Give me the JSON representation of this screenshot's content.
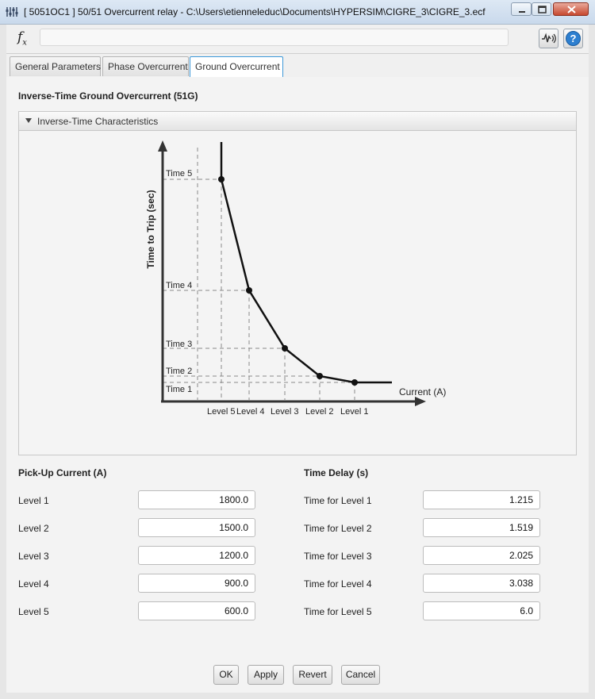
{
  "window": {
    "title": "[ 5051OC1 ]  50/51 Overcurrent relay - C:\\Users\\etienneleduc\\Documents\\HYPERSIM\\CIGRE_3\\CIGRE_3.ecf"
  },
  "toolbar": {
    "formula_value": ""
  },
  "tabs": [
    {
      "label": "General Parameters"
    },
    {
      "label": "Phase Overcurrent"
    },
    {
      "label": "Ground Overcurrent"
    }
  ],
  "section_title": "Inverse-Time Ground Overcurrent (51G)",
  "panel_title": "Inverse-Time Characteristics",
  "diagram": {
    "y_axis_label": "Time to Trip (sec)",
    "x_axis_label": "Current (A)",
    "time_labels": [
      "Time 5",
      "Time 4",
      "Time 3",
      "Time 2",
      "Time 1"
    ],
    "level_labels": [
      "Level 5",
      "Level 4",
      "Level 3",
      "Level 2",
      "Level 1"
    ]
  },
  "pickup": {
    "title": "Pick-Up Current (A)",
    "rows": [
      {
        "label": "Level 1",
        "value": "1800.0"
      },
      {
        "label": "Level 2",
        "value": "1500.0"
      },
      {
        "label": "Level 3",
        "value": "1200.0"
      },
      {
        "label": "Level 4",
        "value": "900.0"
      },
      {
        "label": "Level 5",
        "value": "600.0"
      }
    ]
  },
  "delay": {
    "title": "Time Delay (s)",
    "rows": [
      {
        "label": "Time for Level 1",
        "value": "1.215"
      },
      {
        "label": "Time for Level 2",
        "value": "1.519"
      },
      {
        "label": "Time for Level 3",
        "value": "2.025"
      },
      {
        "label": "Time for Level 4",
        "value": "3.038"
      },
      {
        "label": "Time for Level 5",
        "value": "6.0"
      }
    ]
  },
  "buttons": {
    "ok": "OK",
    "apply": "Apply",
    "revert": "Revert",
    "cancel": "Cancel"
  }
}
